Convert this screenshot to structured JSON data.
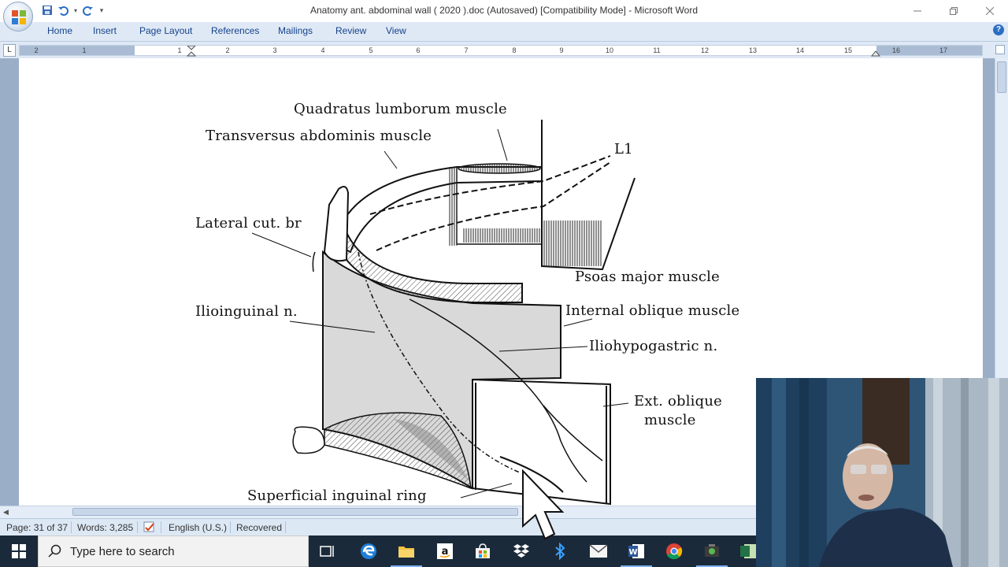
{
  "window": {
    "title": "Anatomy ant. abdominal wall  ( 2020 ).doc (Autosaved) [Compatibility Mode] - Microsoft Word"
  },
  "ribbon": {
    "tabs": [
      "Home",
      "Insert",
      "Page Layout",
      "References",
      "Mailings",
      "Review",
      "View"
    ],
    "help": "?"
  },
  "ruler": {
    "tab_selector": "L",
    "numbers": [
      "2",
      "1",
      "1",
      "2",
      "3",
      "4",
      "5",
      "6",
      "7",
      "8",
      "9",
      "10",
      "11",
      "12",
      "13",
      "14",
      "15",
      "16",
      "17"
    ]
  },
  "figure": {
    "labels": {
      "quadratus": "Quadratus lumborum muscle",
      "transversus": "Transversus abdominis muscle",
      "l1": "L1",
      "lateral_cut": "Lateral cut. br",
      "psoas": "Psoas major muscle",
      "ilioinguinal": "Ilioinguinal n.",
      "internal_oblique": "Internal oblique muscle",
      "iliohypogastric": "Iliohypogastric n.",
      "ext_oblique_1": "Ext. oblique",
      "ext_oblique_2": "muscle",
      "superficial_ring": "Superficial inguinal ring"
    }
  },
  "statusbar": {
    "page": "Page: 31 of 37",
    "words": "Words: 3,285",
    "language": "English (U.S.)",
    "recovered": "Recovered"
  },
  "taskbar": {
    "search_placeholder": "Type here to search",
    "icons": [
      "task-view-icon",
      "edge-icon",
      "file-explorer-icon",
      "amazon-icon",
      "store-icon",
      "dropbox-icon",
      "bluetooth-icon",
      "mail-icon",
      "word-icon",
      "chrome-icon",
      "camtasia-icon",
      "excel-icon"
    ]
  },
  "colors": {
    "ribbon_bg": "#dfe9f5",
    "tab_text": "#15428b",
    "taskbar_bg": "#1b2a3a"
  }
}
